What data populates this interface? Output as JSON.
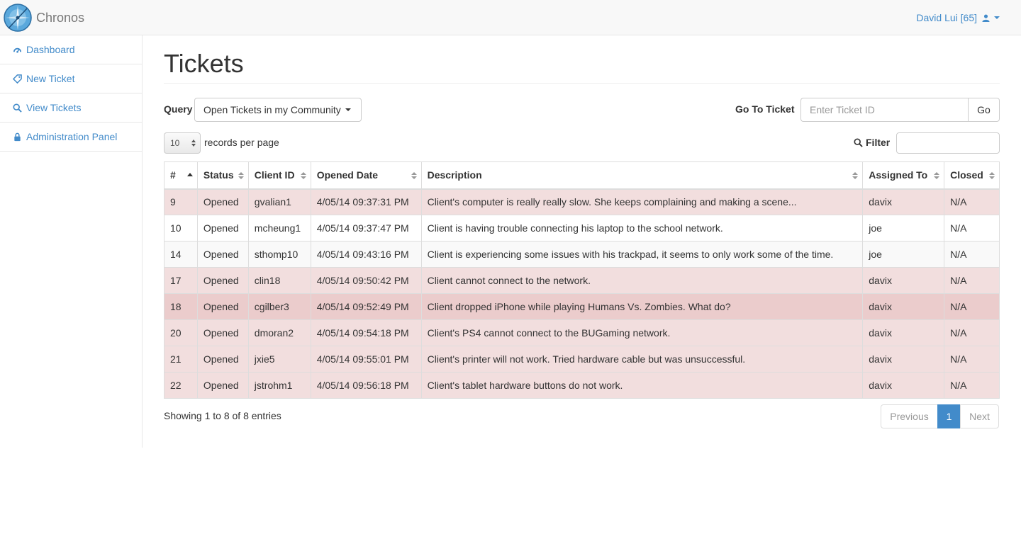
{
  "app": {
    "brand_name": "Chronos",
    "user_label": "David Lui [65]",
    "accent_color": "#428bca"
  },
  "sidebar": {
    "items": [
      {
        "label": "Dashboard",
        "icon": "dashboard-icon"
      },
      {
        "label": "New Ticket",
        "icon": "tag-icon"
      },
      {
        "label": "View Tickets",
        "icon": "search-icon"
      },
      {
        "label": "Administration Panel",
        "icon": "lock-icon"
      }
    ]
  },
  "main": {
    "title": "Tickets",
    "query_label": "Query",
    "query_selected": "Open Tickets in my Community",
    "goto_label": "Go To Ticket",
    "goto_placeholder": "Enter Ticket ID",
    "goto_button": "Go",
    "records_per_page": "10",
    "records_label": "records per page",
    "filter_label": "Filter",
    "filter_value": ""
  },
  "table": {
    "columns": [
      "#",
      "Status",
      "Client ID",
      "Opened Date",
      "Description",
      "Assigned To",
      "Closed"
    ],
    "rows": [
      {
        "id": "9",
        "status": "Opened",
        "client": "gvalian1",
        "date": "4/05/14 09:37:31 PM",
        "desc": "Client's computer is really really slow. She keeps complaining and making a scene...",
        "assigned": "davix",
        "closed": "N/A"
      },
      {
        "id": "10",
        "status": "Opened",
        "client": "mcheung1",
        "date": "4/05/14 09:37:47 PM",
        "desc": "Client is having trouble connecting his laptop to the school network.",
        "assigned": "joe",
        "closed": "N/A"
      },
      {
        "id": "14",
        "status": "Opened",
        "client": "sthomp10",
        "date": "4/05/14 09:43:16 PM",
        "desc": "Client is experiencing some issues with his trackpad, it seems to only work some of the time.",
        "assigned": "joe",
        "closed": "N/A"
      },
      {
        "id": "17",
        "status": "Opened",
        "client": "clin18",
        "date": "4/05/14 09:50:42 PM",
        "desc": "Client cannot connect to the network.",
        "assigned": "davix",
        "closed": "N/A"
      },
      {
        "id": "18",
        "status": "Opened",
        "client": "cgilber3",
        "date": "4/05/14 09:52:49 PM",
        "desc": "Client dropped iPhone while playing Humans Vs. Zombies. What do?",
        "assigned": "davix",
        "closed": "N/A"
      },
      {
        "id": "20",
        "status": "Opened",
        "client": "dmoran2",
        "date": "4/05/14 09:54:18 PM",
        "desc": "Client's PS4 cannot connect to the BUGaming network.",
        "assigned": "davix",
        "closed": "N/A"
      },
      {
        "id": "21",
        "status": "Opened",
        "client": "jxie5",
        "date": "4/05/14 09:55:01 PM",
        "desc": "Client's printer will not work. Tried hardware cable but was unsuccessful.",
        "assigned": "davix",
        "closed": "N/A"
      },
      {
        "id": "22",
        "status": "Opened",
        "client": "jstrohm1",
        "date": "4/05/14 09:56:18 PM",
        "desc": "Client's tablet hardware buttons do not work.",
        "assigned": "davix",
        "closed": "N/A"
      }
    ]
  },
  "footer": {
    "info": "Showing 1 to 8 of 8 entries",
    "prev_label": "Previous",
    "current_page": "1",
    "next_label": "Next"
  }
}
